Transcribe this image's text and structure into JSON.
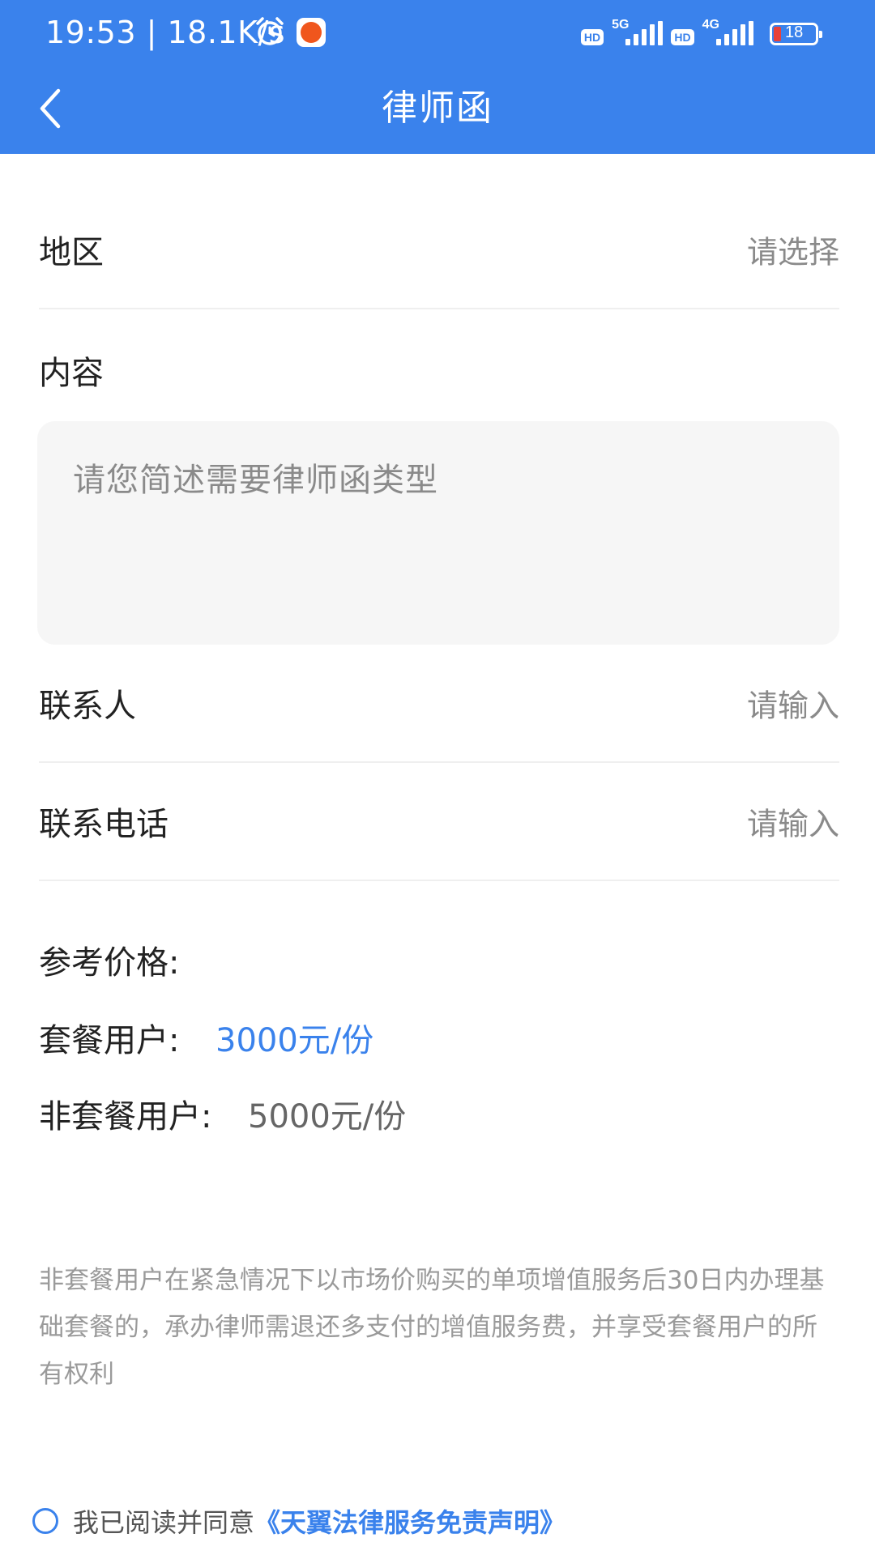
{
  "status_bar": {
    "time": "19:53 | 18.1K/s",
    "network_1": "5G",
    "network_2": "4G",
    "hd_1": "HD",
    "hd_2": "HD",
    "battery_level": "18",
    "icons": [
      "alarm-icon",
      "app-notification-icon",
      "signal-icon",
      "battery-icon"
    ]
  },
  "nav": {
    "title": "律师函",
    "back_icon": "chevron-left-icon"
  },
  "form": {
    "region": {
      "label": "地区",
      "value": "请选择"
    },
    "content": {
      "label": "内容",
      "placeholder": "请您简述需要律师函类型"
    },
    "contact": {
      "label": "联系人",
      "value": "请输入"
    },
    "phone": {
      "label": "联系电话",
      "value": "请输入"
    }
  },
  "pricing": {
    "title": "参考价格:",
    "member_label": "套餐用户:",
    "member_price": "3000元/份",
    "nonmember_label": "非套餐用户:",
    "nonmember_price": "5000元/份"
  },
  "notice": "非套餐用户在紧急情况下以市场价购买的单项增值服务后30日内办理基础套餐的，承办律师需退还多支付的增值服务费，并享受套餐用户的所有权利",
  "agreement": {
    "text": "我已阅读并同意",
    "link": "《天翼法律服务免责声明》"
  },
  "colors": {
    "primary": "#3a82ec",
    "background": "#ffffff",
    "input_background": "#f6f6f6",
    "placeholder": "#8a8a8a",
    "notice_text": "#9a9a9a"
  }
}
